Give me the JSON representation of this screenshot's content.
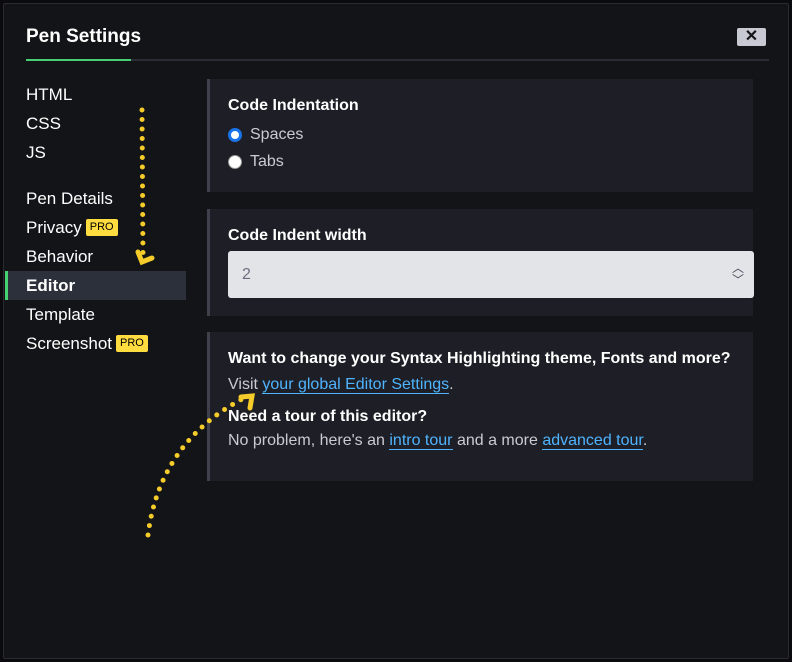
{
  "title": "Pen Settings",
  "close_label": "✕",
  "nav": {
    "items": [
      {
        "label": "HTML"
      },
      {
        "label": "CSS"
      },
      {
        "label": "JS"
      },
      {
        "label": "Pen Details"
      },
      {
        "label": "Privacy",
        "badge": "PRO"
      },
      {
        "label": "Behavior"
      },
      {
        "label": "Editor",
        "active": true
      },
      {
        "label": "Template"
      },
      {
        "label": "Screenshot",
        "badge": "PRO"
      }
    ]
  },
  "indentation": {
    "heading": "Code Indentation",
    "options": [
      {
        "label": "Spaces",
        "checked": true
      },
      {
        "label": "Tabs",
        "checked": false
      }
    ]
  },
  "indent_width": {
    "heading": "Code Indent width",
    "value": "2"
  },
  "info": {
    "q1": "Want to change your Syntax Highlighting theme, Fonts and more?",
    "visit": "Visit ",
    "settings_link": "your global Editor Settings",
    "dot": ".",
    "q2": "Need a tour of this editor?",
    "tour_pre": "No problem, here's an ",
    "intro_link": "intro tour",
    "tour_mid": " and a more ",
    "advanced_link": "advanced tour",
    "tour_end": "."
  },
  "colors": {
    "accent": "#47cf73",
    "pro": "#ffdd40",
    "link": "#4fb4ff",
    "annotation": "#f5cc2a"
  }
}
